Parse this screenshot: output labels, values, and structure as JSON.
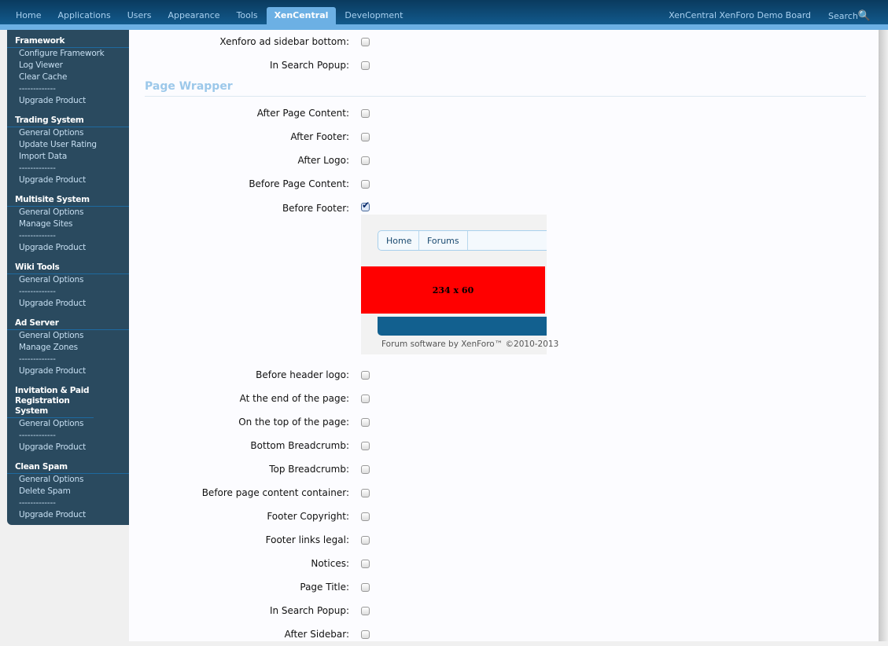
{
  "nav": {
    "tabs": [
      "Home",
      "Applications",
      "Users",
      "Appearance",
      "Tools",
      "XenCentral",
      "Development"
    ],
    "selected": "XenCentral",
    "board": "XenCentral XenForo Demo Board",
    "search": "Search"
  },
  "sidebar": [
    {
      "title": "Framework",
      "items": [
        "Configure Framework",
        "Log Viewer",
        "Clear Cache",
        "-------------",
        "Upgrade Product"
      ]
    },
    {
      "title": "Trading System",
      "items": [
        "General Options",
        "Update User Rating",
        "Import Data",
        "-------------",
        "Upgrade Product"
      ]
    },
    {
      "title": "Multisite System",
      "items": [
        "General Options",
        "Manage Sites",
        "-------------",
        "Upgrade Product"
      ]
    },
    {
      "title": "Wiki Tools",
      "items": [
        "General Options",
        "-------------",
        "Upgrade Product"
      ]
    },
    {
      "title": "Ad Server",
      "items": [
        "General Options",
        "Manage Zones",
        "-------------",
        "Upgrade Product"
      ]
    },
    {
      "title": "Invitation & Paid Registration System",
      "items": [
        "General Options",
        "-------------",
        "Upgrade Product"
      ]
    },
    {
      "title": "Clean Spam",
      "items": [
        "General Options",
        "Delete Spam",
        "-------------",
        "Upgrade Product"
      ]
    }
  ],
  "top_rows": [
    {
      "label": "Xenforo ad sidebar bottom:",
      "checked": false
    },
    {
      "label": "In Search Popup:",
      "checked": false
    }
  ],
  "section_title": "Page Wrapper",
  "rows_a": [
    {
      "label": "After Page Content:",
      "checked": false
    },
    {
      "label": "After Footer:",
      "checked": false
    },
    {
      "label": "After Logo:",
      "checked": false
    },
    {
      "label": "Before Page Content:",
      "checked": false
    },
    {
      "label": "Before Footer:",
      "checked": true
    }
  ],
  "preview": {
    "crumbs": [
      "Home",
      "Forums"
    ],
    "ad_label": "234 x 60",
    "ad_color": "#ff0000",
    "copyright": "Forum software by XenForo™ ©2010-2013"
  },
  "rows_b": [
    {
      "label": "Before header logo:",
      "checked": false
    },
    {
      "label": "At the end of the page:",
      "checked": false
    },
    {
      "label": "On the top of the page:",
      "checked": false
    },
    {
      "label": "Bottom Breadcrumb:",
      "checked": false
    },
    {
      "label": "Top Breadcrumb:",
      "checked": false
    },
    {
      "label": "Before page content container:",
      "checked": false
    },
    {
      "label": "Footer Copyright:",
      "checked": false
    },
    {
      "label": "Footer links legal:",
      "checked": false
    },
    {
      "label": "Notices:",
      "checked": false
    },
    {
      "label": "Page Title:",
      "checked": false
    },
    {
      "label": "In Search Popup:",
      "checked": false
    },
    {
      "label": "After Sidebar:",
      "checked": false
    }
  ]
}
